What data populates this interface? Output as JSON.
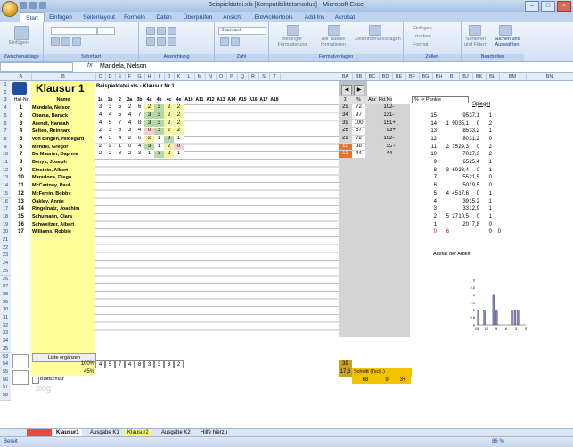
{
  "window": {
    "title": "Beispieldatei.xls [Kompatibilitätsmodus] - Microsoft Excel"
  },
  "ribbon": {
    "tabs": [
      "Start",
      "Einfügen",
      "Seitenlayout",
      "Formeln",
      "Daten",
      "Überprüfen",
      "Ansicht",
      "Entwicklertools",
      "Add-Ins",
      "Acrobat"
    ],
    "active_tab": "Start",
    "groups": [
      "Zwischenablage",
      "Schriftart",
      "Ausrichtung",
      "Zahl",
      "Formatvorlagen",
      "Zellen",
      "Bearbeiten"
    ],
    "paste_label": "Einfügen",
    "number_format": "Standard",
    "cond_format_label": "Bedingte Formatierung",
    "as_table_label": "Als Tabelle formatieren",
    "cell_styles_label": "Zellenformatvorlagen",
    "insert_label": "Einfügen",
    "delete_label": "Löschen",
    "format_label": "Format",
    "sort_label": "Sortieren und Filtern",
    "find_label": "Suchen und Auswählen"
  },
  "formula_bar": {
    "name_box": "",
    "fx": "fx",
    "value": "Mandela, Nelson"
  },
  "columns": [
    "A",
    "B",
    "C",
    "D",
    "E",
    "F",
    "G",
    "H",
    "I",
    "J",
    "K",
    "L",
    "M",
    "N",
    "O",
    "P",
    "Q",
    "R",
    "S",
    "T",
    "BA",
    "BB",
    "BC",
    "BD",
    "BE",
    "BF",
    "BG",
    "BH",
    "BI",
    "BJ",
    "BK",
    "BL",
    "BM",
    "BN"
  ],
  "sheet": {
    "title": "Klausur 1",
    "file_label": "Beispieldatei.xls - Klausur Nr.1",
    "header_hallnr": "Hall-Nr",
    "header_name": "Name",
    "task_headers": [
      "1a",
      "1b",
      "2",
      "3a",
      "3b",
      "4a",
      "4b",
      "4c",
      "4e",
      "A10",
      "A11",
      "A12",
      "A13",
      "A14",
      "A15",
      "A16",
      "A17",
      "A18"
    ],
    "sum_headers": [
      "Σ",
      "%",
      "Abz",
      "Pkt.Note"
    ],
    "dropdown": "% -> Punkte",
    "spiegel_label": "Spiegel",
    "students": [
      {
        "nr": "1",
        "name": "Mandela, Nelson",
        "scores": [
          "3",
          "3",
          "5",
          "2",
          "6",
          "2",
          "3",
          "2",
          "2"
        ],
        "sum": "29",
        "pct": "72",
        "note": "10",
        "grade": "2-"
      },
      {
        "nr": "2",
        "name": "Obama, Barack",
        "scores": [
          "4",
          "4",
          "5",
          "4",
          "7",
          "3",
          "3",
          "2",
          "2"
        ],
        "sum": "34",
        "pct": "97",
        "note": "13",
        "grade": "1-"
      },
      {
        "nr": "3",
        "name": "Arendt, Hannah",
        "scores": [
          "4",
          "5",
          "7",
          "4",
          "8",
          "3",
          "3",
          "2",
          "2"
        ],
        "sum": "39",
        "pct": "100",
        "note": "15",
        "grade": "1+"
      },
      {
        "nr": "4",
        "name": "Selten, Reinhard",
        "scores": [
          "2",
          "3",
          "6",
          "3",
          "4",
          "0",
          "3",
          "2",
          "2"
        ],
        "sum": "26",
        "pct": "67",
        "note": "9",
        "grade": "3+"
      },
      {
        "nr": "5",
        "name": "von Bingen, Hildegard",
        "scores": [
          "4",
          "5",
          "4",
          "2",
          "6",
          "2",
          "1",
          "3",
          "1"
        ],
        "sum": "29",
        "pct": "72",
        "note": "10",
        "grade": "2-"
      },
      {
        "nr": "6",
        "name": "Mendel, Gregor",
        "scores": [
          "2",
          "2",
          "1",
          "0",
          "4",
          "3",
          "1",
          "2",
          "0"
        ],
        "sum": "15",
        "pct": "38",
        "note": "3",
        "grade": "5+"
      },
      {
        "nr": "7",
        "name": "Du Maurier, Daphne",
        "scores": [
          "2",
          "2",
          "3",
          "2",
          "3",
          "1",
          "3",
          "2",
          "1"
        ],
        "sum": "12",
        "pct": "44",
        "note": "4",
        "grade": "4-"
      },
      {
        "nr": "8",
        "name": "Benys, Joseph"
      },
      {
        "nr": "9",
        "name": "Einstein, Albert"
      },
      {
        "nr": "10",
        "name": "Maradona, Diego"
      },
      {
        "nr": "11",
        "name": "McCartney, Paul"
      },
      {
        "nr": "12",
        "name": "McFerrin, Bobby"
      },
      {
        "nr": "13",
        "name": "Oakley, Annie"
      },
      {
        "nr": "14",
        "name": "Ringelnatz, Joachim"
      },
      {
        "nr": "15",
        "name": "Schumann, Clara"
      },
      {
        "nr": "16",
        "name": "Schweitzer, Albert"
      },
      {
        "nr": "17",
        "name": "Williams, Robbie"
      }
    ],
    "extra_rows": [
      "18",
      "19",
      "20",
      "21",
      "22",
      "23",
      "24",
      "25",
      "26",
      "27",
      "28",
      "29",
      "30",
      "31",
      "32",
      "33"
    ],
    "spiegel": [
      [
        "15",
        "",
        "",
        "95",
        "37,1",
        "1",
        ""
      ],
      [
        "14",
        "1",
        "90",
        "35,1",
        "0",
        "2",
        ""
      ],
      [
        "13",
        "",
        "",
        "85",
        "33,2",
        "1",
        ""
      ],
      [
        "12",
        "",
        "",
        "80",
        "31,2",
        "0",
        ""
      ],
      [
        "11",
        "2",
        "75",
        "29,3",
        "0",
        "2",
        ""
      ],
      [
        "10",
        "",
        "",
        "70",
        "27,3",
        "2",
        ""
      ],
      [
        "9",
        "",
        "",
        "65",
        "25,4",
        "1",
        ""
      ],
      [
        "8",
        "3",
        "60",
        "23,4",
        "0",
        "1",
        ""
      ],
      [
        "7",
        "",
        "",
        "55",
        "21,5",
        "0",
        ""
      ],
      [
        "6",
        "",
        "",
        "50",
        "19,5",
        "0",
        ""
      ],
      [
        "5",
        "4",
        "45",
        "17,6",
        "0",
        "1",
        ""
      ],
      [
        "4",
        "",
        "",
        "39",
        "15,2",
        "1",
        ""
      ],
      [
        "3",
        "",
        "",
        "33",
        "12,9",
        "1",
        ""
      ],
      [
        "2",
        "5",
        "27",
        "10,5",
        "0",
        "1",
        ""
      ],
      [
        "1",
        "",
        "",
        "20",
        "7,8",
        "0",
        ""
      ],
      [
        "0",
        "6",
        "",
        "",
        "",
        "0",
        "0"
      ]
    ],
    "chart_title": "Ausfall der Arbeit",
    "liste_label": "Liste ergänzen",
    "blattschutz_label": "Blattschutz",
    "blog_label": "blog",
    "row54_pct": "100%",
    "row55_pct": "45%",
    "row54_values": [
      "4",
      "5",
      "7",
      "4",
      "8",
      "3",
      "3",
      "3",
      "2"
    ],
    "row54_sum": "39",
    "row55_sum": "17,6",
    "schnitt_label": "Schnitt (Tsch.)",
    "schnitt_val1": "68",
    "schnitt_val2": "9",
    "schnitt_val3": "3+",
    "bottom_rows": [
      "53",
      "54",
      "55",
      "56",
      "57",
      "58"
    ]
  },
  "chart_data": {
    "type": "bar",
    "title": "Ausfall der Arbeit",
    "categories": [
      "15",
      "14",
      "13",
      "12",
      "11",
      "10",
      "9",
      "8",
      "7",
      "6",
      "5",
      "4",
      "3",
      "2",
      "1",
      "0"
    ],
    "values": [
      1,
      0,
      1,
      0,
      0,
      2,
      1,
      0,
      0,
      0,
      0,
      1,
      1,
      1,
      0,
      0
    ],
    "ylim": [
      0,
      3
    ],
    "yticks": [
      "0",
      "0,5",
      "1",
      "1,5",
      "2",
      "2,5",
      "3"
    ],
    "xticks": [
      "15",
      "12",
      "9",
      "6",
      "3",
      "0"
    ]
  },
  "sheet_tabs": [
    "Klausur1",
    "Ausgabe K1",
    "Klausur2",
    "Ausgabe K2",
    "Hilfe hierzu"
  ],
  "statusbar": {
    "left": "Bereit",
    "zoom": "86 %"
  }
}
